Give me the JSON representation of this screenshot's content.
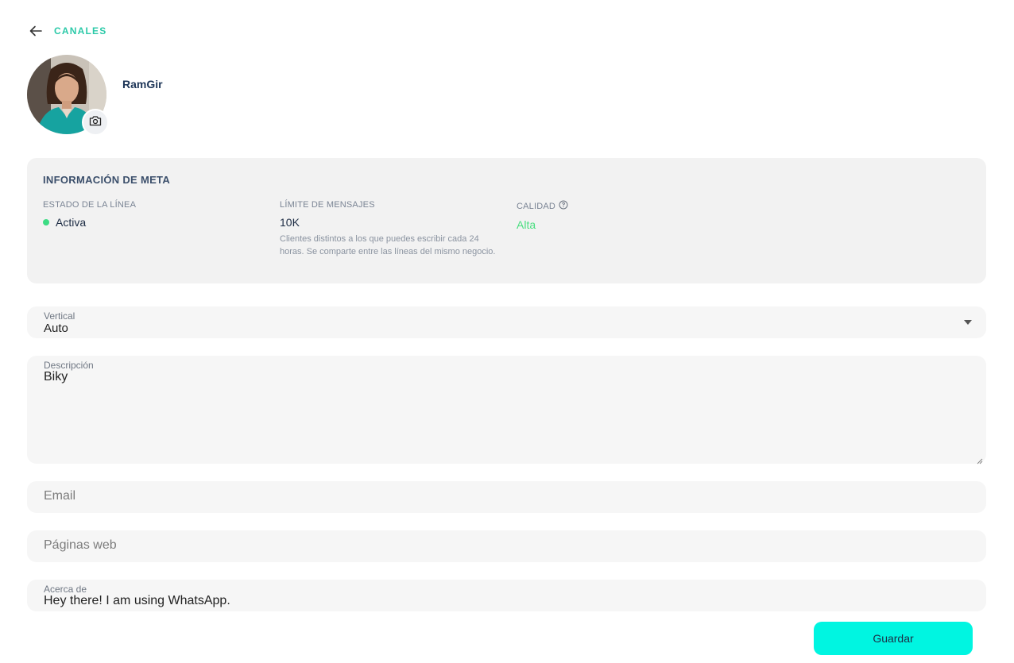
{
  "header": {
    "back_label": "CANALES"
  },
  "profile": {
    "name": "RamGir"
  },
  "meta": {
    "title": "INFORMACIÓN DE META",
    "status": {
      "label": "ESTADO DE LA LÍNEA",
      "value": "Activa",
      "color": "#3ddc84"
    },
    "limit": {
      "label": "LÍMITE DE MENSAJES",
      "value": "10K",
      "note": "Clientes distintos a los que puedes escribir cada 24 horas. Se comparte entre las líneas del mismo negocio."
    },
    "quality": {
      "label": "CALIDAD",
      "value": "Alta",
      "color": "#4ade80"
    }
  },
  "form": {
    "vertical": {
      "label": "Vertical",
      "value": "Auto"
    },
    "description": {
      "label": "Descripción",
      "value": "Biky"
    },
    "email": {
      "placeholder": "Email"
    },
    "websites": {
      "placeholder": "Páginas web"
    },
    "about": {
      "label": "Acerca de",
      "value": "Hey there! I am using WhatsApp."
    }
  },
  "actions": {
    "save_label": "Guardar",
    "accent": "#00f5e1"
  }
}
